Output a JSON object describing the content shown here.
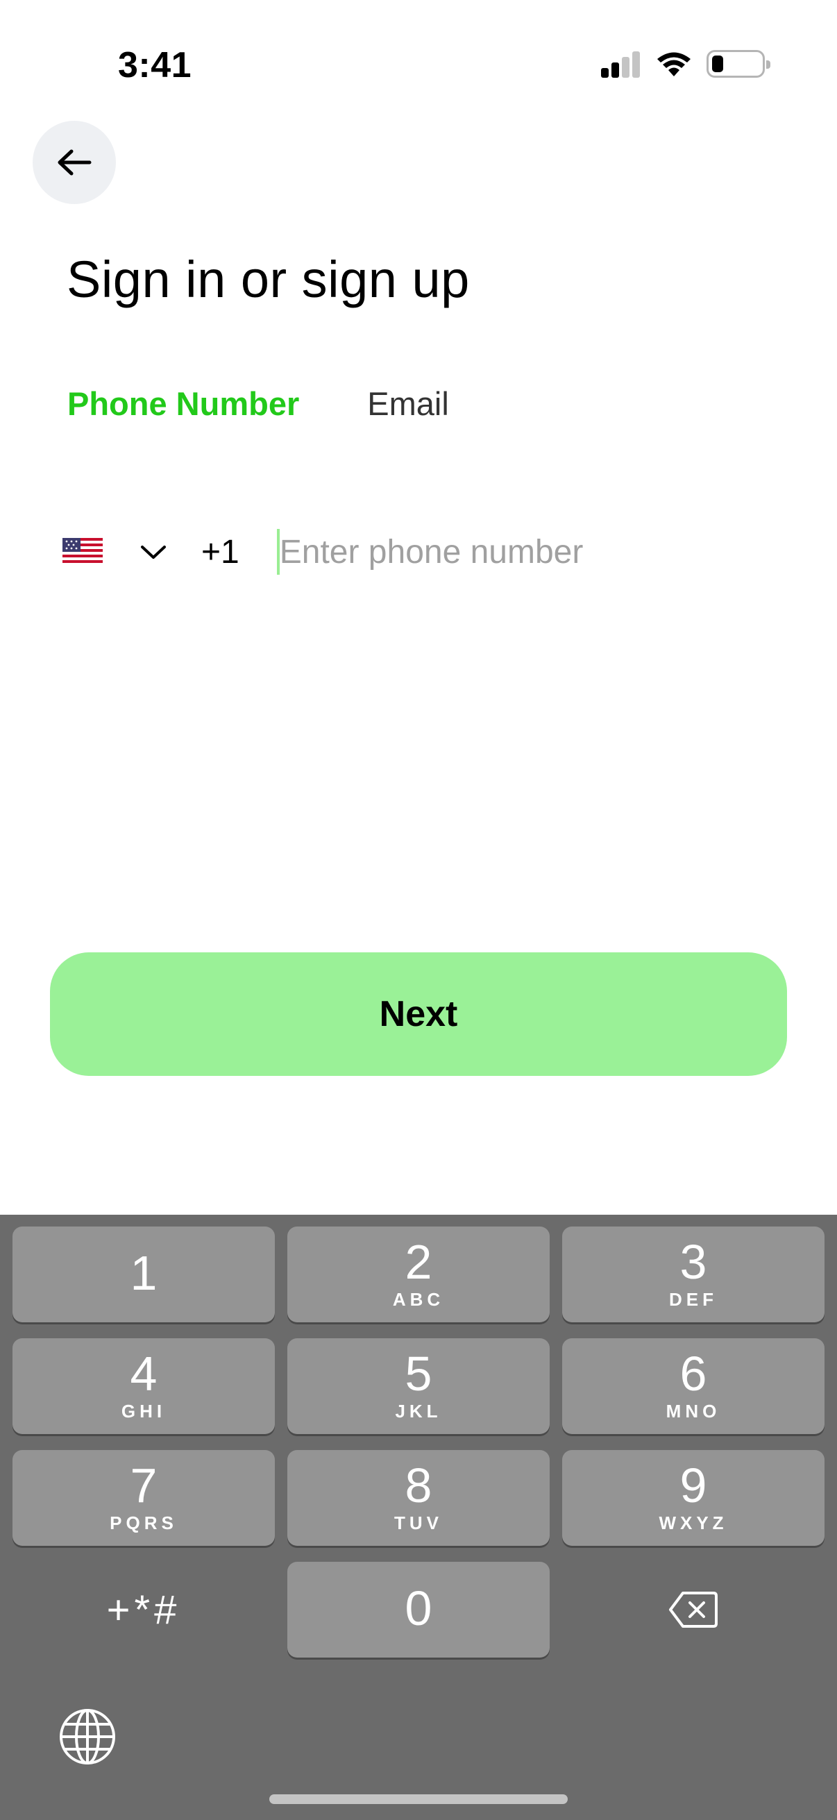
{
  "status_bar": {
    "time": "3:41"
  },
  "header": {
    "title": "Sign in or sign up"
  },
  "tabs": [
    {
      "label": "Phone Number",
      "active": true
    },
    {
      "label": "Email",
      "active": false
    }
  ],
  "phone": {
    "country_code": "+1",
    "placeholder": "Enter phone number",
    "value": ""
  },
  "next_label": "Next",
  "keyboard": {
    "keys": [
      {
        "num": "1",
        "letters": ""
      },
      {
        "num": "2",
        "letters": "ABC"
      },
      {
        "num": "3",
        "letters": "DEF"
      },
      {
        "num": "4",
        "letters": "GHI"
      },
      {
        "num": "5",
        "letters": "JKL"
      },
      {
        "num": "6",
        "letters": "MNO"
      },
      {
        "num": "7",
        "letters": "PQRS"
      },
      {
        "num": "8",
        "letters": "TUV"
      },
      {
        "num": "9",
        "letters": "WXYZ"
      },
      {
        "num": "0",
        "letters": ""
      }
    ],
    "symbols": "+*#"
  },
  "colors": {
    "accent_green": "#22c91a",
    "button_green": "#9af197",
    "keyboard_bg": "#6b6b6b",
    "key_bg": "#949494"
  }
}
